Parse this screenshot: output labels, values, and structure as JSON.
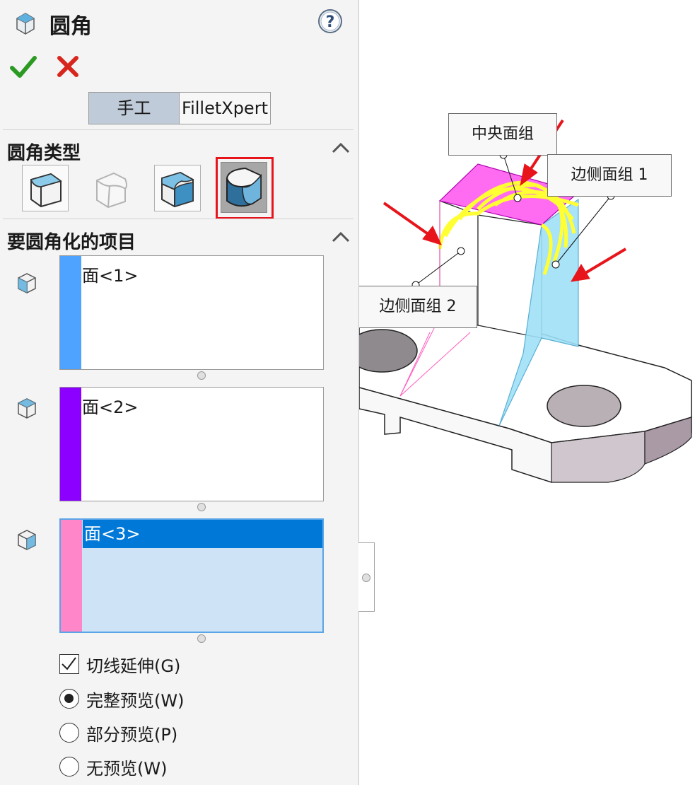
{
  "header": {
    "title": "圆角",
    "help_icon": "question-mark-icon",
    "title_icon": "fillet-feature-icon"
  },
  "actions": {
    "ok_icon": "checkmark-icon",
    "cancel_icon": "close-icon"
  },
  "tabs": [
    {
      "label": "手工",
      "active": true
    },
    {
      "label": "FilletXpert",
      "active": false
    }
  ],
  "fillet_type": {
    "title": "圆角类型",
    "options": [
      {
        "icon": "constant-size-fillet-icon",
        "selected": false
      },
      {
        "icon": "variable-size-fillet-icon",
        "selected": false
      },
      {
        "icon": "face-fillet-icon",
        "selected": false
      },
      {
        "icon": "full-round-fillet-icon",
        "selected": true
      }
    ]
  },
  "items": {
    "title": "要圆角化的项目",
    "lists": [
      {
        "icon": "side-face-set-1-icon",
        "color": "#4da3ff",
        "entries": [
          "面<1>"
        ]
      },
      {
        "icon": "center-face-set-icon",
        "color": "#8b00ff",
        "entries": [
          "面<2>"
        ]
      },
      {
        "icon": "side-face-set-2-icon",
        "color": "#ff86c8",
        "entries": [
          "面<3>"
        ],
        "active": true
      }
    ]
  },
  "options": {
    "tangent_propagation": {
      "label": "切线延伸(G)",
      "checked": true
    },
    "preview": [
      {
        "label": "完整预览(W)",
        "selected": true
      },
      {
        "label": "部分预览(P)",
        "selected": false
      },
      {
        "label": "无预览(W)",
        "selected": false
      }
    ]
  },
  "viewport": {
    "callouts": {
      "center": "中央面组",
      "side1": "边侧面组 1",
      "side2": "边侧面组 2"
    },
    "colors": {
      "center_face": "#ff5cf0",
      "side_face_1": "#7fd6f5",
      "side_face_2": "#ff86c8",
      "highlight": "#ffff33",
      "arrow": "#e8141b"
    }
  }
}
